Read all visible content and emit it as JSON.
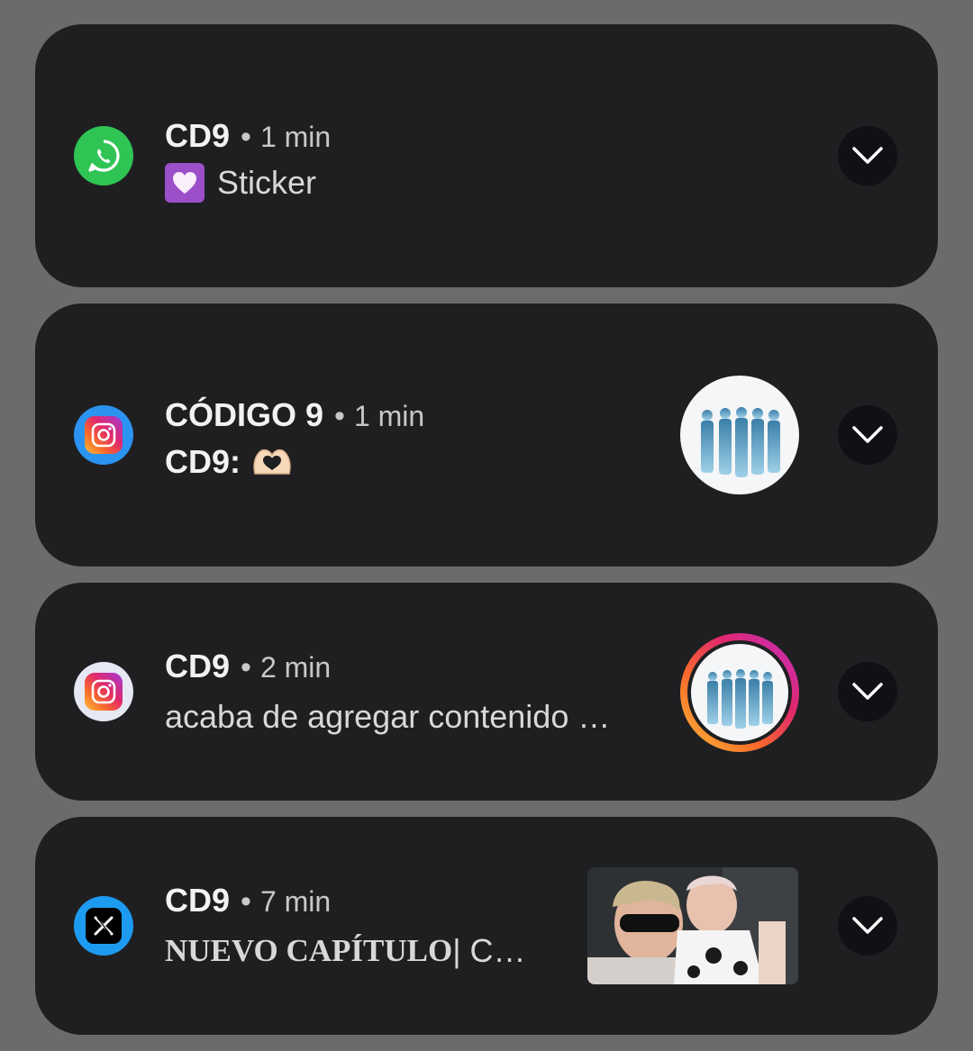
{
  "notifications": [
    {
      "app_icon": "whatsapp-icon",
      "sender": "CD9",
      "separator": "•",
      "time": "1 min",
      "emoji": "white-heart-emoji",
      "body": "Sticker"
    },
    {
      "app_icon": "instagram-icon",
      "sender": "CÓDIGO 9",
      "separator": "•",
      "time": "1 min",
      "body": "CD9:",
      "emoji": "heart-hands-emoji"
    },
    {
      "app_icon": "instagram-icon",
      "sender": "CD9",
      "separator": "•",
      "time": "2 min",
      "body": "acaba de agregar contenido …"
    },
    {
      "app_icon": "x-icon",
      "sender": "CD9",
      "separator": "•",
      "time": "7 min",
      "body_bold": "NUEVO CAPÍTULO",
      "body": " | C…"
    }
  ],
  "colors": {
    "background": "#6b6b6b",
    "card": "#1f1f21",
    "expand_button": "#101115",
    "whatsapp_green": "#2fc454",
    "twitter_blue": "#1d9bf0"
  }
}
